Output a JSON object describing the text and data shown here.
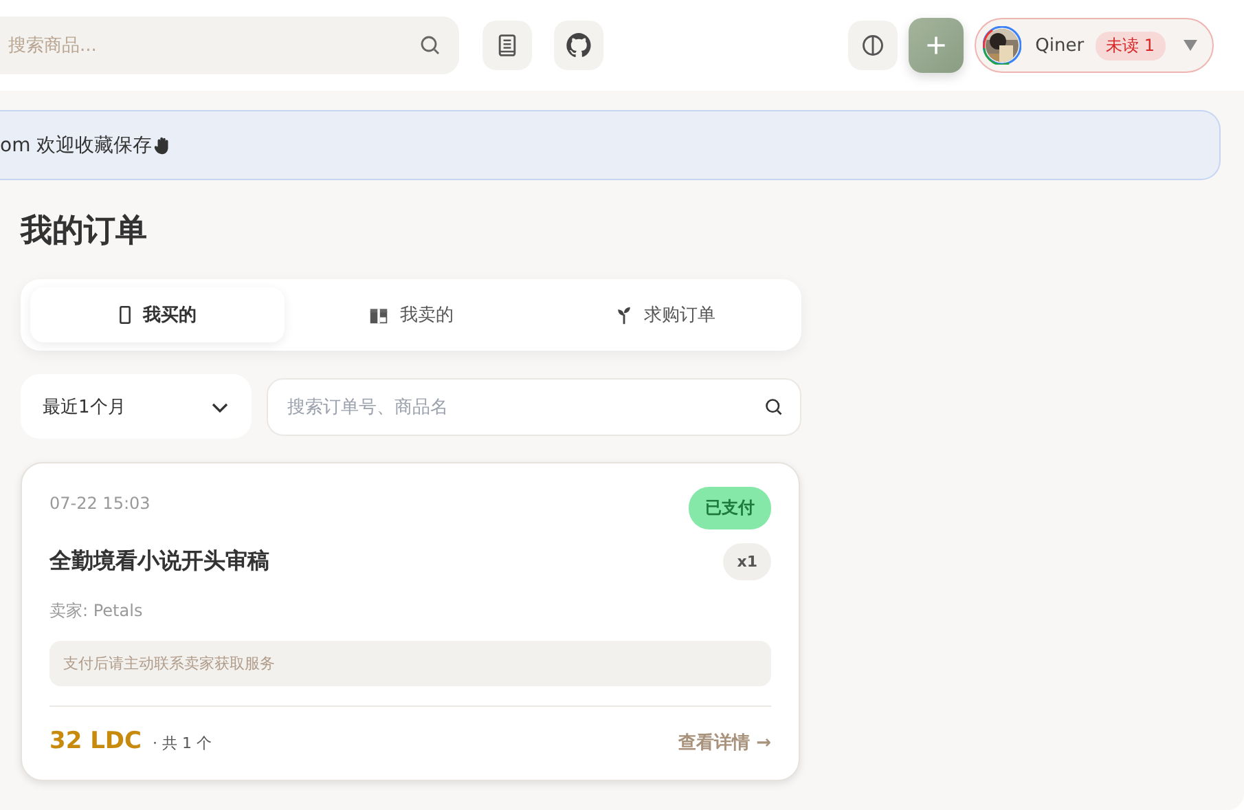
{
  "header": {
    "search": {
      "placeholder": "搜索商品..."
    },
    "user": {
      "name": "Qiner",
      "unread": "未读 1"
    }
  },
  "banner": {
    "text": "om 欢迎收藏保存"
  },
  "page_title": "我的订单",
  "tabs": [
    {
      "label": "我买的",
      "kind": "phone",
      "selected": true
    },
    {
      "label": "我卖的",
      "kind": "gift",
      "selected": false
    },
    {
      "label": "求购订单",
      "kind": "sprout",
      "selected": false
    }
  ],
  "filters": {
    "period": "最近1个月",
    "search": {
      "placeholder": "搜索订单号、商品名"
    }
  },
  "orders": [
    {
      "time": "07-22 15:03",
      "status": "已支付",
      "title": "全勤境看小说开头审稿",
      "quantity": "x1",
      "seller": "卖家: Petals",
      "note": "支付后请主动联系卖家获取服务",
      "price": "32 LDC",
      "count": "· 共 1 个",
      "action": "查看详情 →"
    }
  ]
}
